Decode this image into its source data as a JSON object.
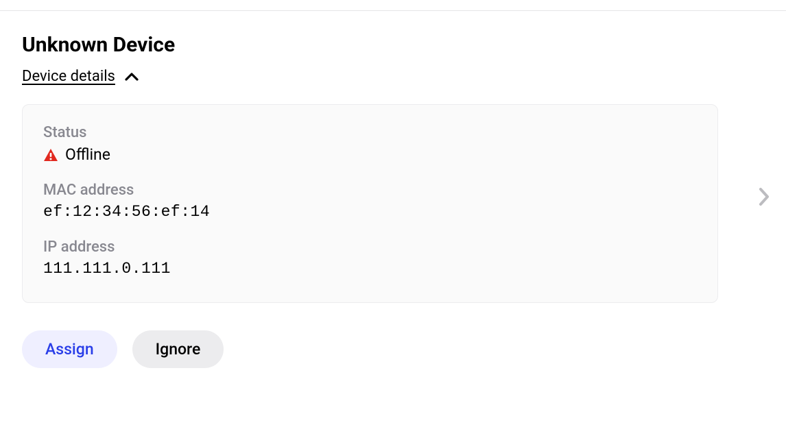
{
  "device": {
    "title": "Unknown Device",
    "details_toggle_label": "Device details",
    "status_label": "Status",
    "status_value": "Offline",
    "mac_label": "MAC address",
    "mac_value": "ef:12:34:56:ef:14",
    "ip_label": "IP address",
    "ip_value": "111.111.0.111"
  },
  "buttons": {
    "assign": "Assign",
    "ignore": "Ignore"
  }
}
